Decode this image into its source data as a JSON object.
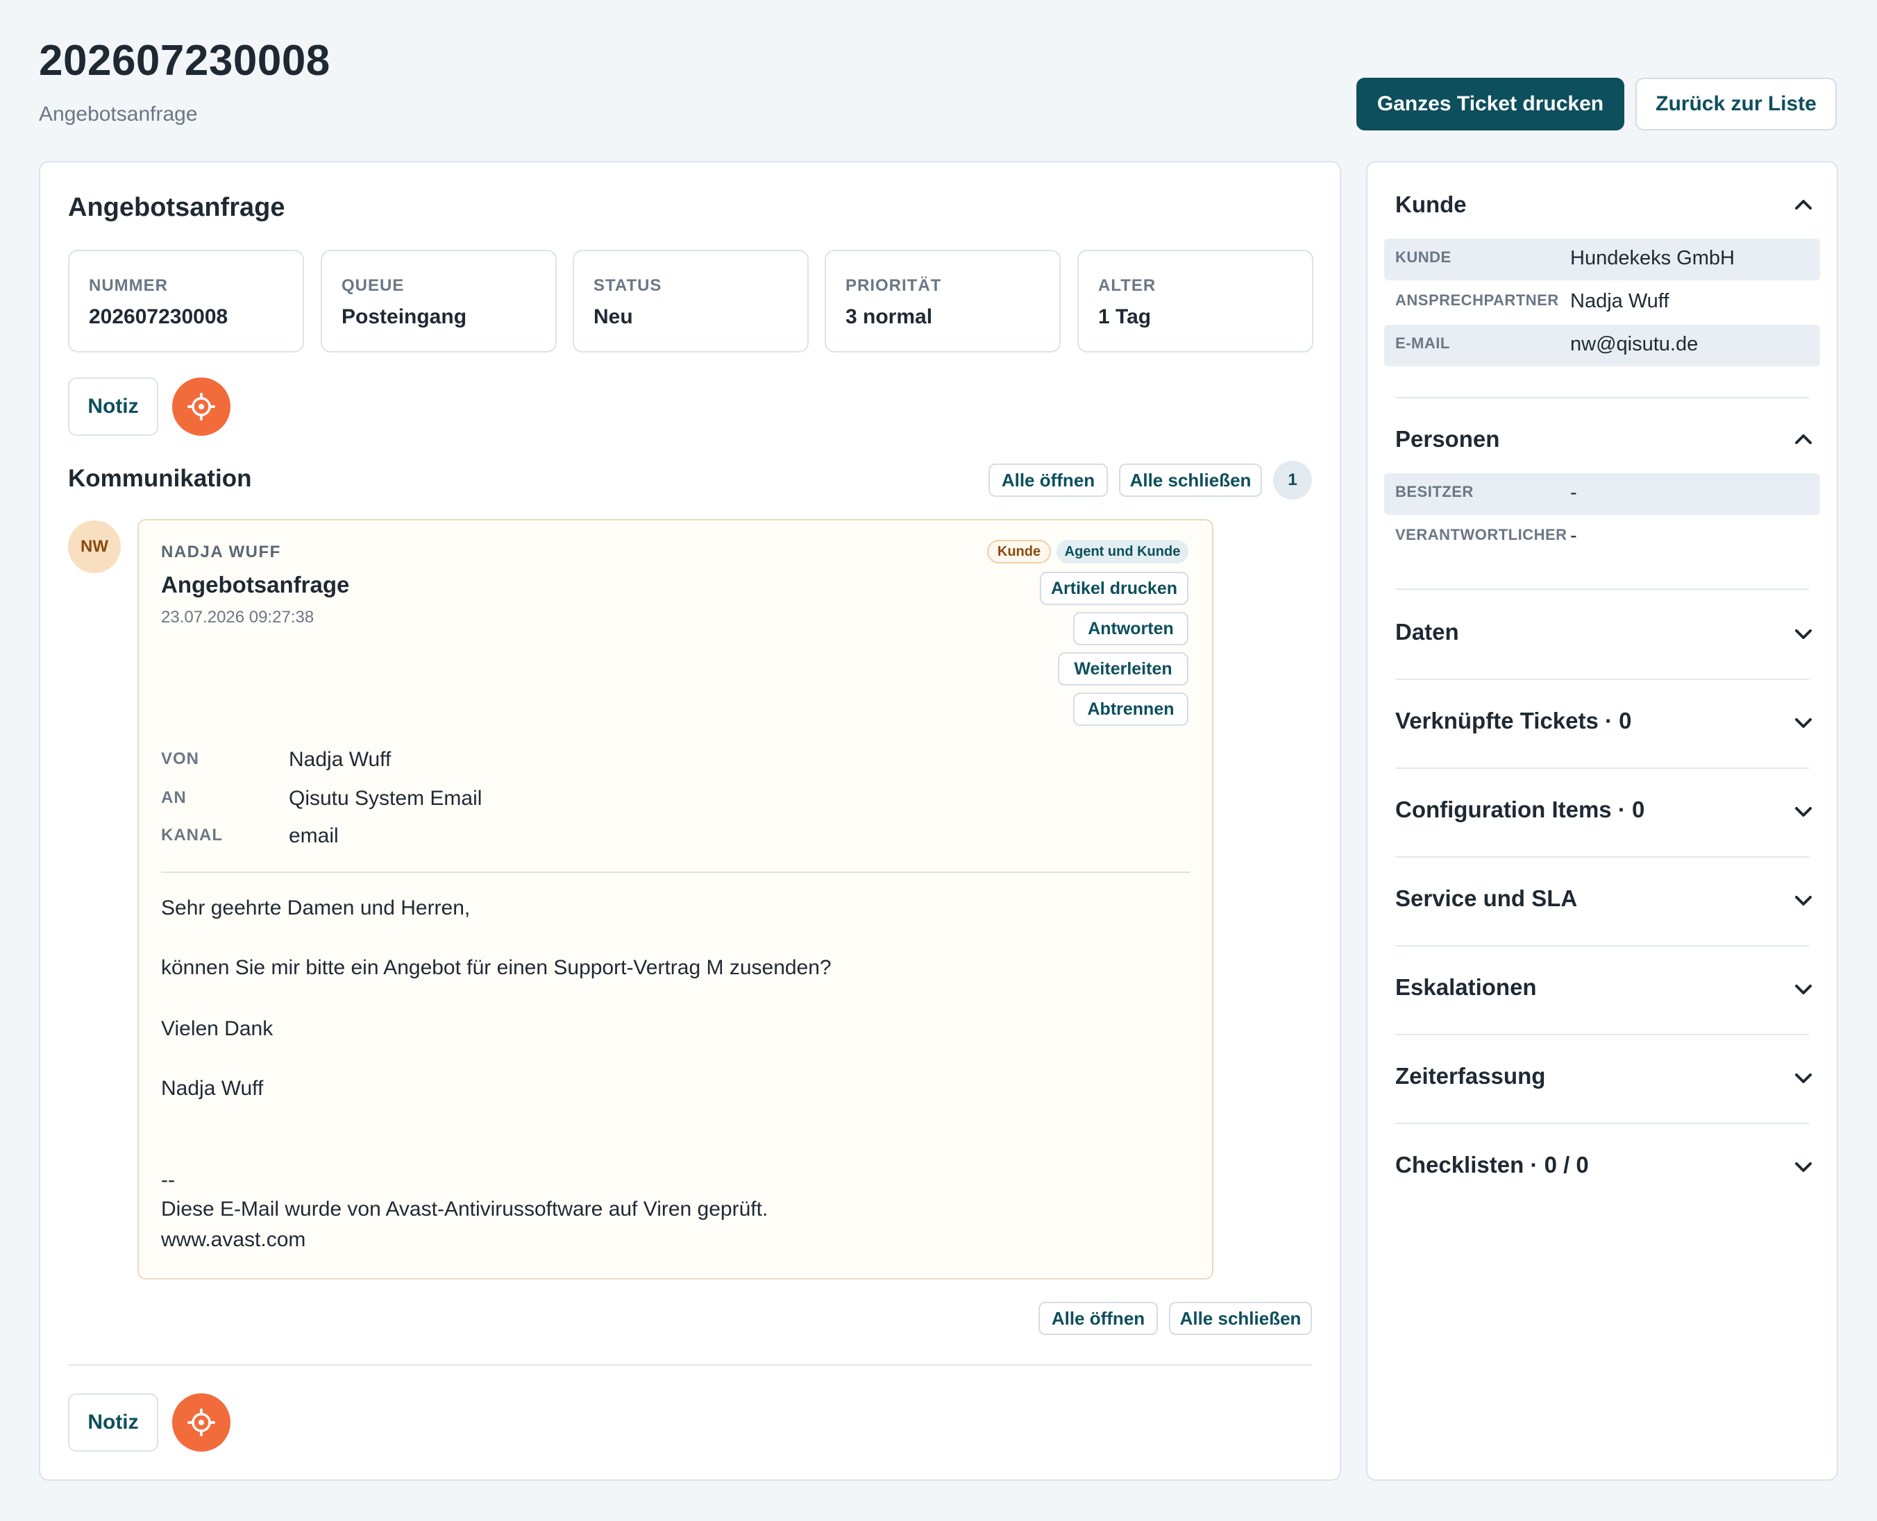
{
  "header": {
    "ticket_number": "202607230008",
    "subtitle": "Angebotsanfrage",
    "print_all_label": "Ganzes Ticket drucken",
    "back_label": "Zurück zur Liste"
  },
  "main": {
    "title": "Angebotsanfrage",
    "info": [
      {
        "label": "NUMMER",
        "value": "202607230008"
      },
      {
        "label": "QUEUE",
        "value": "Posteingang"
      },
      {
        "label": "STATUS",
        "value": "Neu"
      },
      {
        "label": "PRIORITÄT",
        "value": "3 normal"
      },
      {
        "label": "ALTER",
        "value": "1 Tag"
      }
    ],
    "note_label": "Notiz",
    "communication": {
      "title": "Kommunikation",
      "open_all": "Alle öffnen",
      "close_all": "Alle schließen",
      "count": "1"
    },
    "article": {
      "avatar_initials": "NW",
      "sender": "NADJA WUFF",
      "subject": "Angebotsanfrage",
      "timestamp": "23.07.2026 09:27:38",
      "tag_customer": "Kunde",
      "tag_visibility": "Agent und Kunde",
      "actions": [
        "Artikel drucken",
        "Antworten",
        "Weiterleiten",
        "Abtrennen"
      ],
      "meta": [
        {
          "label": "VON",
          "value": "Nadja Wuff"
        },
        {
          "label": "AN",
          "value": "Qisutu System Email"
        },
        {
          "label": "KANAL",
          "value": "email"
        }
      ],
      "body": [
        "Sehr geehrte Damen und Herren,",
        "können Sie mir bitte ein Angebot für einen Support-Vertrag M zusenden?",
        "Vielen Dank",
        "Nadja Wuff",
        "--",
        "Diese E-Mail wurde von Avast-Antivirussoftware auf Viren geprüft.",
        "www.avast.com"
      ]
    }
  },
  "sidebar": {
    "customer": {
      "title": "Kunde",
      "rows": [
        {
          "label": "KUNDE",
          "value": "Hundekeks GmbH"
        },
        {
          "label": "ANSPRECHPARTNER",
          "value": "Nadja Wuff"
        },
        {
          "label": "E-MAIL",
          "value": "nw@qisutu.de"
        }
      ]
    },
    "persons": {
      "title": "Personen",
      "rows": [
        {
          "label": "BESITZER",
          "value": "-"
        },
        {
          "label": "VERANTWORTLICHER",
          "value": "-"
        }
      ]
    },
    "sections": [
      "Daten",
      "Verknüpfte Tickets · 0",
      "Configuration Items · 0",
      "Service und SLA",
      "Eskalationen",
      "Zeiterfassung",
      "Checklisten · 0 / 0"
    ]
  },
  "colors": {
    "primary": "#0d4f5c",
    "accent_orange": "#f26b3a",
    "background": "#f3f6f9",
    "article_bg": "#fffdf8"
  }
}
